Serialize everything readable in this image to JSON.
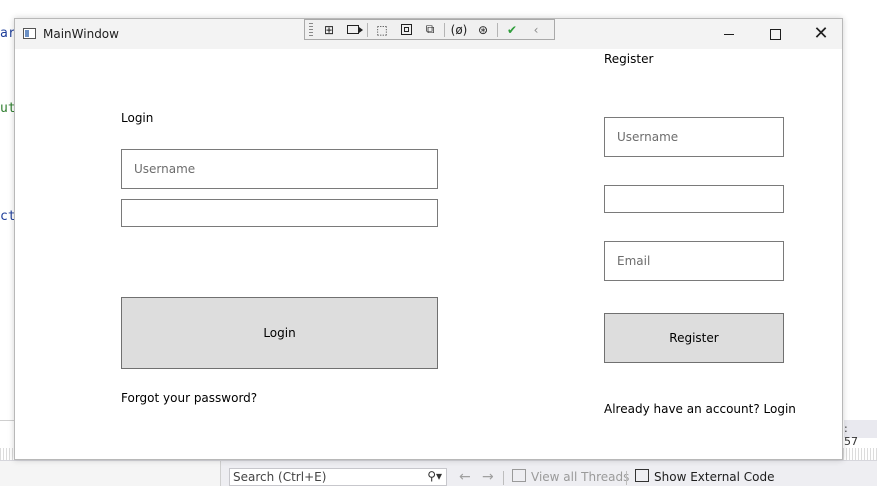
{
  "background_ide": {
    "code_fragments": [
      "ar",
      "ut",
      "ct"
    ],
    "status_value": ": 57",
    "search_placeholder": "Search (Ctrl+E)",
    "view_all_threads": "View all Threads",
    "show_external_code": "Show External Code"
  },
  "window": {
    "title": "MainWindow",
    "debug_toolbar_icons": [
      "grip-icon",
      "live-visual-tree-icon",
      "record-icon",
      "select-element-icon",
      "display-adorners-icon",
      "track-focus-icon",
      "binding-failures-icon",
      "accessibility-icon",
      "checkmark-icon",
      "collapse-toolbar-icon"
    ]
  },
  "login": {
    "heading": "Login",
    "username_placeholder": "Username",
    "password_value": "",
    "button_label": "Login",
    "forgot_password": "Forgot your password?"
  },
  "register": {
    "heading": "Register",
    "username_placeholder": "Username",
    "password_value": "",
    "email_placeholder": "Email",
    "button_label": "Register",
    "already_have_account": "Already have an account? Login"
  },
  "colors": {
    "button_background": "#dddddd",
    "field_border": "#7a7a7a",
    "check_green": "#2e9e3a"
  }
}
